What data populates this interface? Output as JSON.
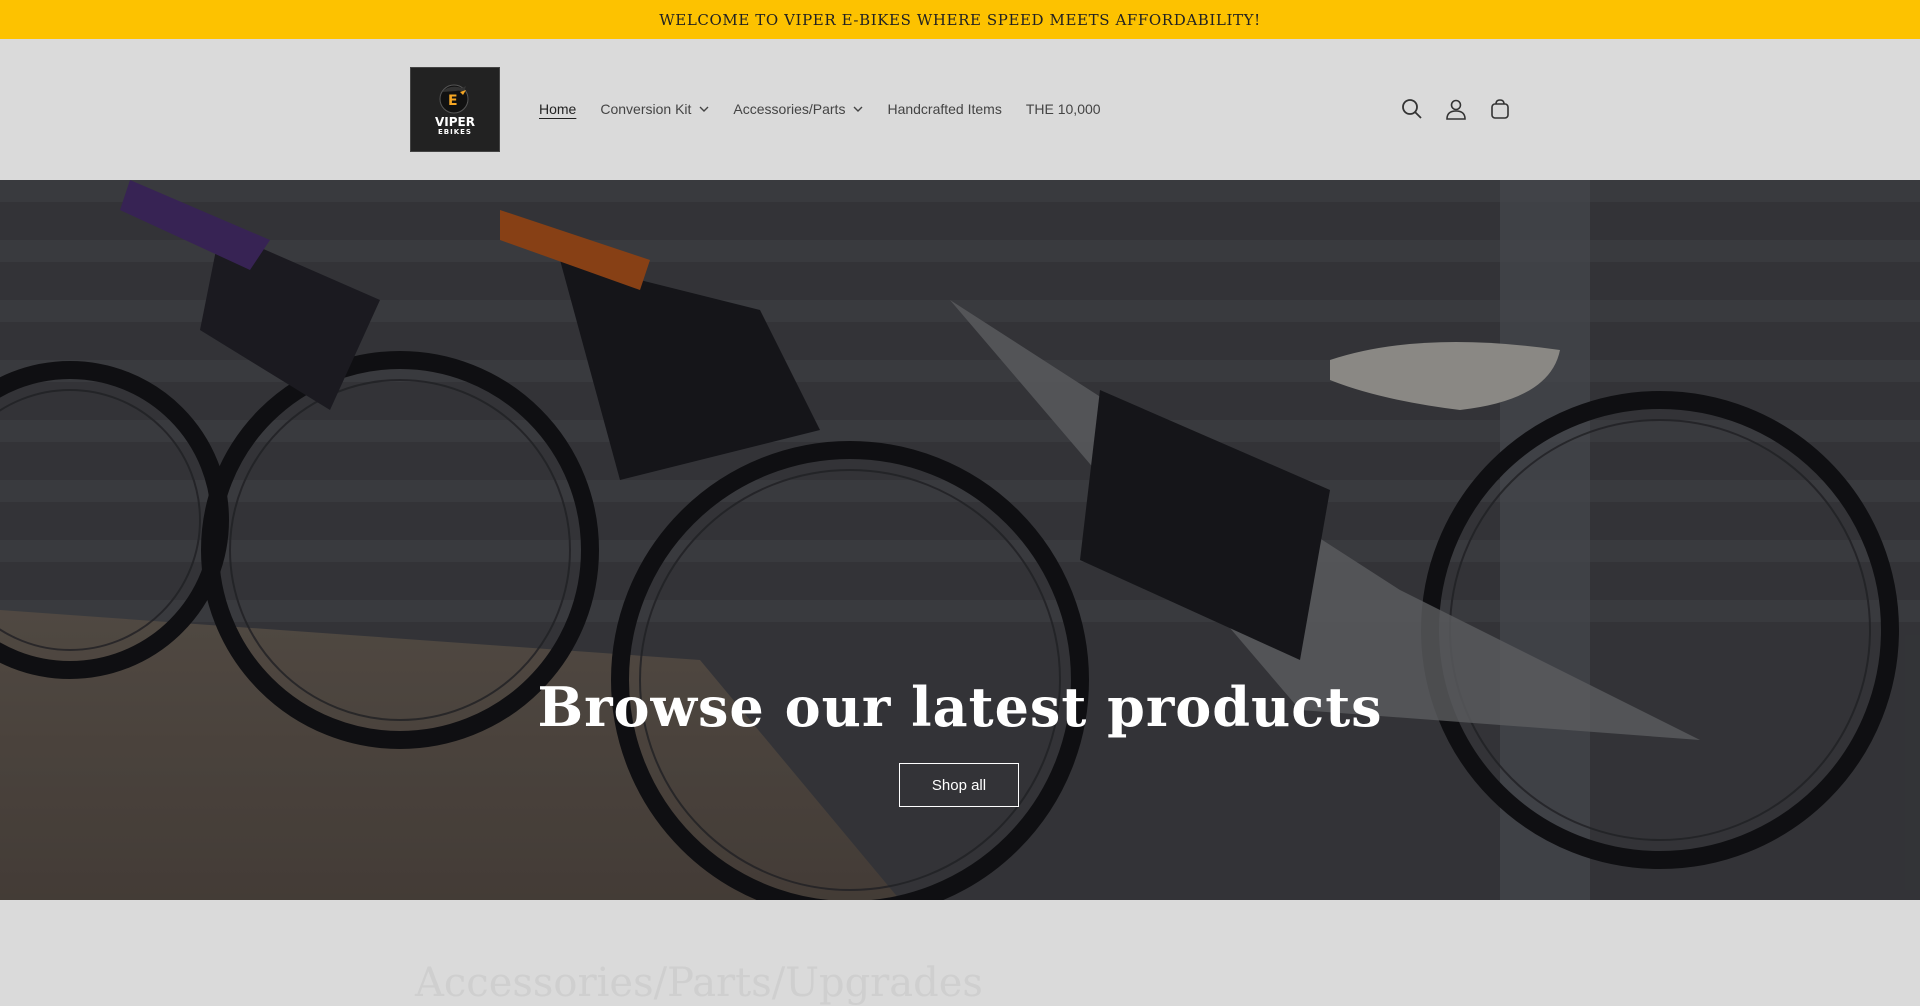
{
  "announcement": {
    "text": "WELCOME TO VIPER E-BIKES WHERE SPEED MEETS AFFORDABILITY!"
  },
  "logo": {
    "name": "VIPER",
    "sub": "EBIKES",
    "mark": "E"
  },
  "nav": {
    "items": [
      {
        "label": "Home",
        "active": true,
        "dropdown": false
      },
      {
        "label": "Conversion Kit",
        "active": false,
        "dropdown": true
      },
      {
        "label": "Accessories/Parts",
        "active": false,
        "dropdown": true
      },
      {
        "label": "Handcrafted Items",
        "active": false,
        "dropdown": false
      },
      {
        "label": "THE 10,000",
        "active": false,
        "dropdown": false
      }
    ]
  },
  "header_icons": [
    "search-icon",
    "account-icon",
    "cart-icon"
  ],
  "hero": {
    "title": "Browse our latest products",
    "button": "Shop all"
  },
  "next_section": {
    "title": "Accessories/Parts/Upgrades"
  },
  "colors": {
    "announcement_bg": "#fdc200",
    "header_bg": "#dadada",
    "hero_text": "#ffffff"
  }
}
